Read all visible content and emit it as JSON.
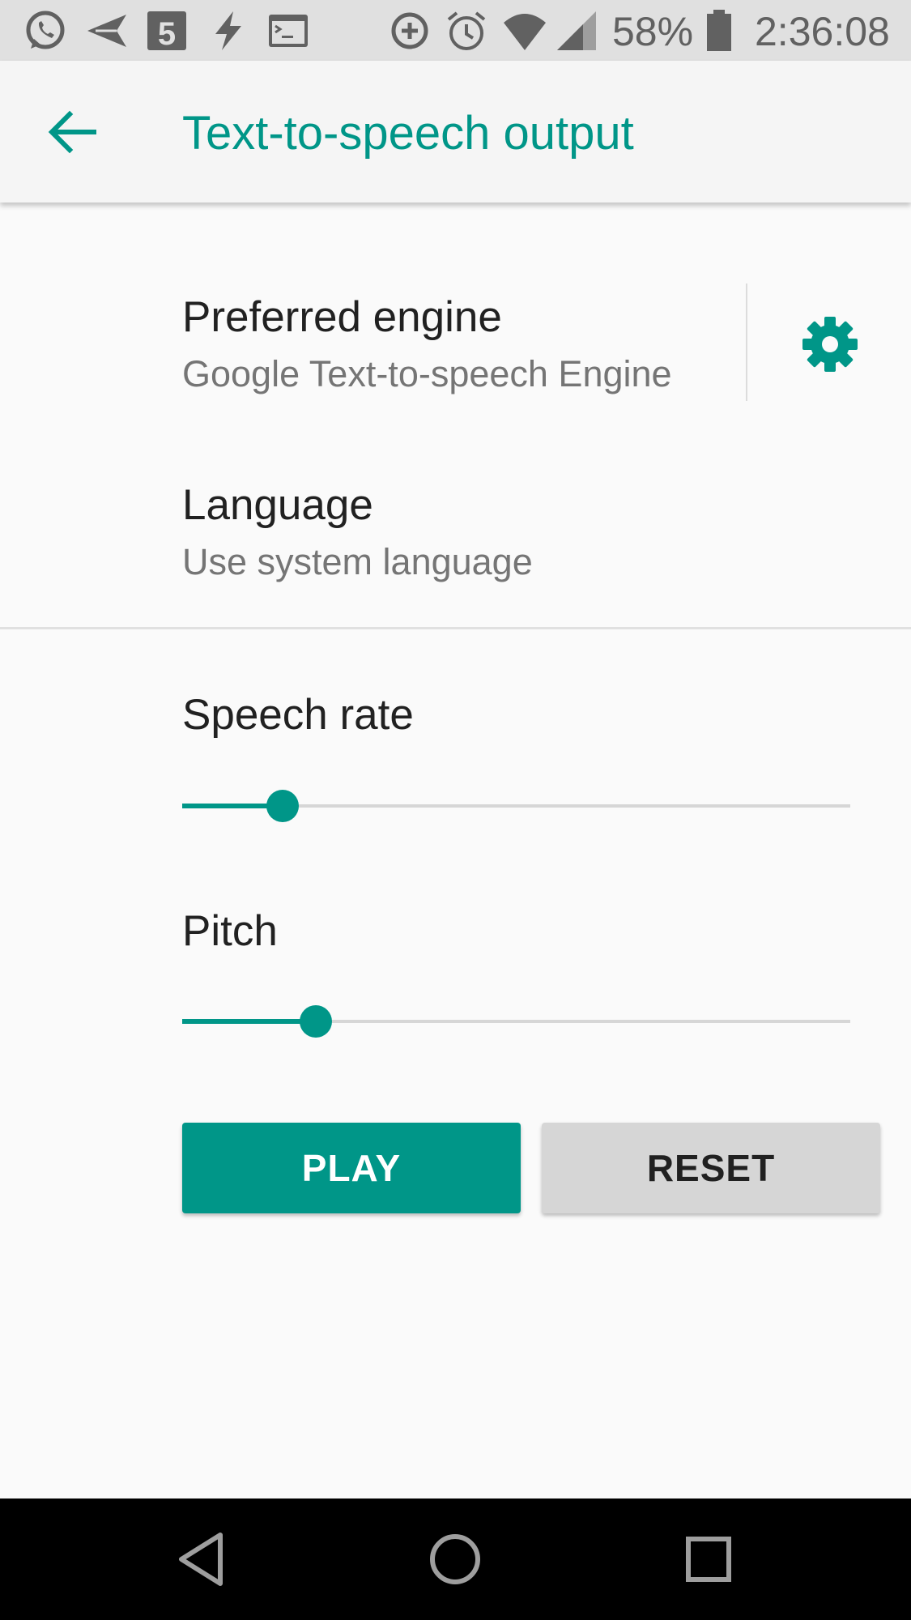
{
  "status_bar": {
    "icons": [
      "whatsapp-icon",
      "send-icon",
      "app-5-icon",
      "flash-icon",
      "terminal-icon",
      "data-saver-icon",
      "alarm-icon",
      "wifi-icon",
      "signal-icon",
      "battery-icon"
    ],
    "battery_percent": "58%",
    "time": "2:36:08"
  },
  "toolbar": {
    "back_icon": "arrow-back-icon",
    "title": "Text-to-speech output"
  },
  "preferences": {
    "engine": {
      "title": "Preferred engine",
      "summary": "Google Text-to-speech Engine",
      "settings_icon": "gear-icon"
    },
    "language": {
      "title": "Language",
      "summary": "Use system language"
    }
  },
  "sliders": {
    "speech_rate": {
      "label": "Speech rate",
      "value_fraction": 0.15
    },
    "pitch": {
      "label": "Pitch",
      "value_fraction": 0.2
    }
  },
  "buttons": {
    "play": "PLAY",
    "reset": "RESET"
  },
  "nav_bar": {
    "icons": [
      "back-triangle-icon",
      "home-circle-icon",
      "recents-square-icon"
    ]
  },
  "colors": {
    "accent": "#009688",
    "status_bar": "#e0e0e0",
    "toolbar": "#f5f5f5",
    "background": "#fafafa",
    "nav_bar": "#000000"
  }
}
